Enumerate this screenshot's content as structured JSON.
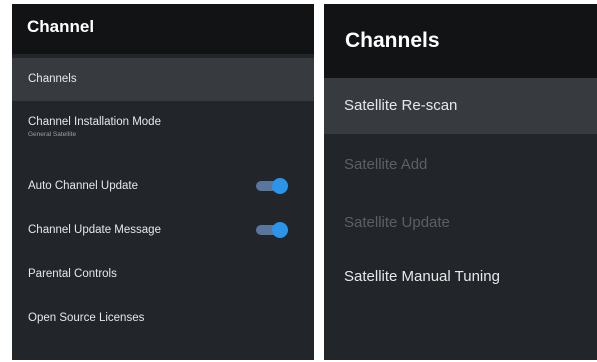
{
  "left_panel": {
    "title": "Channel",
    "items": [
      {
        "label": "Channels",
        "selected": true
      },
      {
        "label": "Channel Installation Mode",
        "sub_label": "General Satellite"
      },
      {
        "label": "Auto Channel Update",
        "toggle_on": true
      },
      {
        "label": "Channel Update Message",
        "toggle_on": true
      },
      {
        "label": "Parental Controls"
      },
      {
        "label": "Open Source Licenses"
      }
    ]
  },
  "right_panel": {
    "title": "Channels",
    "items": [
      {
        "label": "Satellite Re-scan",
        "selected": true
      },
      {
        "label": "Satellite Add",
        "enabled": false
      },
      {
        "label": "Satellite Update",
        "enabled": false
      },
      {
        "label": "Satellite Manual Tuning"
      }
    ]
  },
  "colors": {
    "panel_bg": "#222529",
    "header_bg": "#111315",
    "selected_bg": "#373b40",
    "toggle_knob": "#2b95ea",
    "toggle_track": "#58779a"
  }
}
